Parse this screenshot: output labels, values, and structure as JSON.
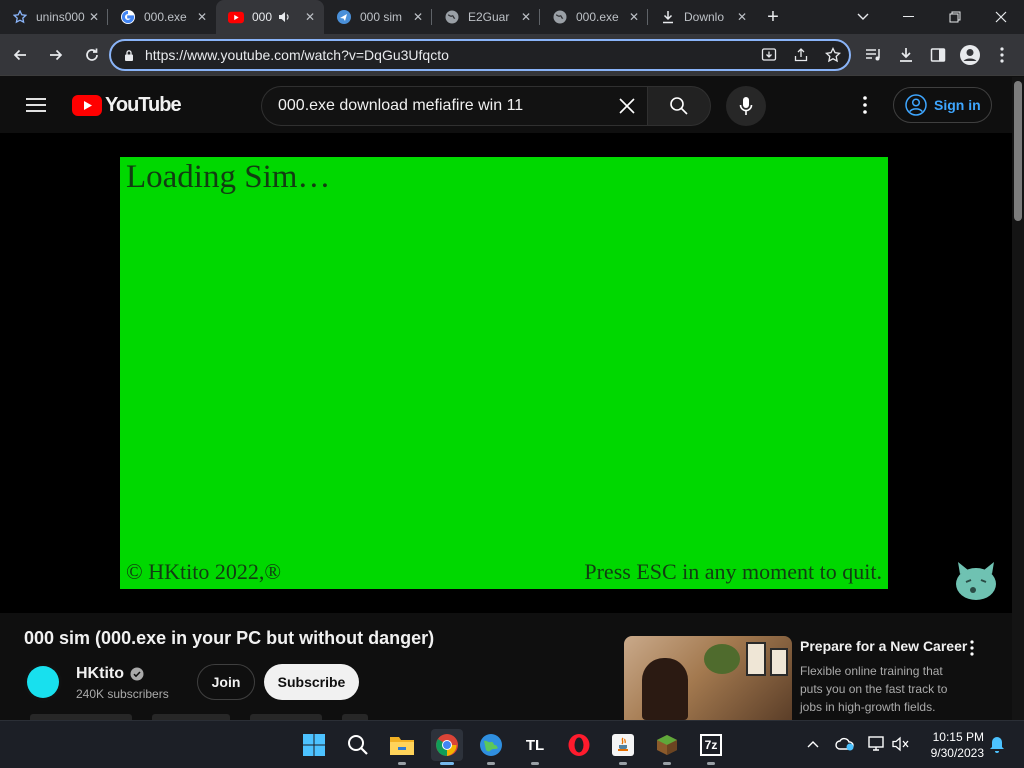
{
  "browser": {
    "tabs": [
      {
        "label": "unins000",
        "icon": "star-icon"
      },
      {
        "label": "000.exe",
        "icon": "google-icon"
      },
      {
        "label": "000",
        "icon": "youtube-icon",
        "active": true
      },
      {
        "label": "000 sim",
        "icon": "sim-icon"
      },
      {
        "label": "E2Guar",
        "icon": "globe-icon"
      },
      {
        "label": "000.exe",
        "icon": "globe-icon"
      },
      {
        "label": "Downlo",
        "icon": "download-icon"
      }
    ],
    "url": "https://www.youtube.com/watch?v=DqGu3Ufqcto"
  },
  "youtube": {
    "brand": "YouTube",
    "search_query": "000.exe download mefiafire win 11",
    "sign_in": "Sign in",
    "video": {
      "loading_text": "Loading Sim…",
      "copyright": "© HKtito 2022,®",
      "quit_text": "Press ESC in any moment to quit."
    },
    "title": "000 sim (000.exe in your PC but without danger)",
    "channel": {
      "name": "HKtito",
      "subscribers": "240K subscribers"
    },
    "join_label": "Join",
    "subscribe_label": "Subscribe",
    "ad": {
      "title": "Prepare for a New Career",
      "description": "Flexible online training that puts you on the fast track to jobs in high-growth fields."
    }
  },
  "taskbar": {
    "clock_time": "10:15 PM",
    "clock_date": "9/30/2023",
    "apps": [
      "windows-start-icon",
      "search-icon",
      "file-explorer-icon",
      "chrome-icon",
      "globe-app-icon",
      "tl-app-icon",
      "opera-icon",
      "java-icon",
      "minecraft-icon",
      "7zip-icon"
    ],
    "tl_label": "TL",
    "sevenzip_label": "7z"
  },
  "colors": {
    "video_green": "#00d800",
    "youtube_red": "#ff0000",
    "link_blue": "#3ea6ff",
    "omnibox_focus": "#8ab4f8"
  }
}
